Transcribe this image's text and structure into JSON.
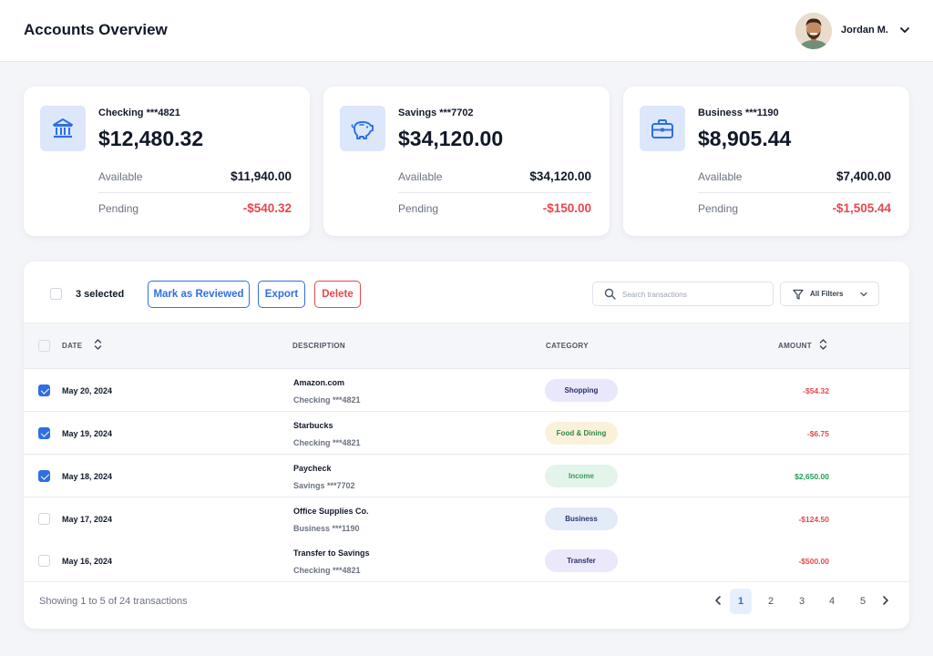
{
  "header": {
    "title": "Accounts Overview",
    "user_name": "Jordan M."
  },
  "accounts": [
    {
      "name": "Checking ***4821",
      "balance": "$12,480.32",
      "available_label": "Available",
      "available": "$11,940.00",
      "pending_label": "Pending",
      "pending": "-$540.32",
      "icon": "bank-icon"
    },
    {
      "name": "Savings ***7702",
      "balance": "$34,120.00",
      "available_label": "Available",
      "available": "$34,120.00",
      "pending_label": "Pending",
      "pending": "-$150.00",
      "icon": "piggy-bank-icon"
    },
    {
      "name": "Business ***1190",
      "balance": "$8,905.44",
      "available_label": "Available",
      "available": "$7,400.00",
      "pending_label": "Pending",
      "pending": "-$1,505.44",
      "icon": "briefcase-icon"
    }
  ],
  "toolbar": {
    "selected_text": "3 selected",
    "mark_reviewed_label": "Mark as Reviewed",
    "export_label": "Export",
    "delete_label": "Delete",
    "search_placeholder": "Search transactions",
    "filters_label": "All Filters"
  },
  "table": {
    "columns": [
      "DATE",
      "DESCRIPTION",
      "CATEGORY",
      "AMOUNT"
    ],
    "rows": [
      {
        "checked": true,
        "date": "May 20, 2024",
        "description": "Amazon.com",
        "account": "Checking ***4821",
        "category": "Shopping",
        "amount": "-$54.32",
        "sign": "neg"
      },
      {
        "checked": true,
        "date": "May 19, 2024",
        "description": "Starbucks",
        "account": "Checking ***4821",
        "category": "Food & Dining",
        "amount": "-$6.75",
        "sign": "neg"
      },
      {
        "checked": true,
        "date": "May 18, 2024",
        "description": "Paycheck",
        "account": "Savings ***7702",
        "category": "Income",
        "amount": "$2,650.00",
        "sign": "pos"
      },
      {
        "checked": false,
        "date": "May 17, 2024",
        "description": "Office Supplies Co.",
        "account": "Business ***1190",
        "category": "Business",
        "amount": "-$124.50",
        "sign": "neg"
      },
      {
        "checked": false,
        "date": "May 16, 2024",
        "description": "Transfer to Savings",
        "account": "Checking ***4821",
        "category": "Transfer",
        "amount": "-$500.00",
        "sign": "neg"
      }
    ]
  },
  "category_colors": {
    "Shopping": {
      "bg": "#e8e7fb",
      "fg": "#2b2d6e"
    },
    "Food & Dining": {
      "bg": "#fbf1da",
      "fg": "#2e8a47"
    },
    "Income": {
      "bg": "#e3f4ea",
      "fg": "#3a9a5c"
    },
    "Business": {
      "bg": "#e3eaf8",
      "fg": "#2a3a6a"
    },
    "Transfer": {
      "bg": "#ebe8fb",
      "fg": "#2b2d6e"
    }
  },
  "colors": {
    "accent": "#2f6fe4",
    "danger": "#e5484d",
    "success": "#1e9e52"
  },
  "pagination": {
    "summary": "Showing 1 to 5 of 24 transactions",
    "pages": [
      "1",
      "2",
      "3",
      "4",
      "5"
    ],
    "current": "1"
  }
}
